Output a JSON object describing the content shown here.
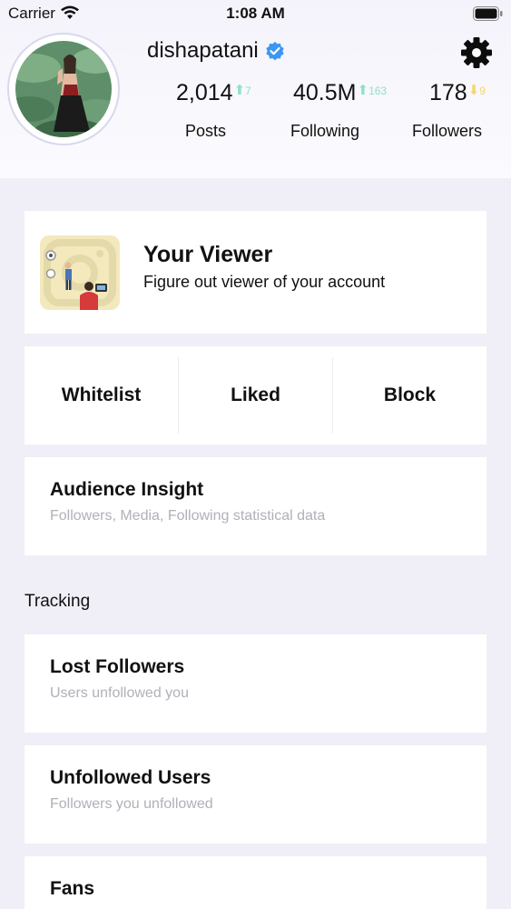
{
  "status_bar": {
    "carrier": "Carrier",
    "time": "1:08 AM"
  },
  "profile": {
    "username": "dishapatani",
    "verified_color": "#3b97f1",
    "stats": {
      "posts": {
        "value": "2,014",
        "delta": "7",
        "direction": "up",
        "label": "Posts"
      },
      "following": {
        "value": "40.5M",
        "delta": "163",
        "direction": "up",
        "label": "Following"
      },
      "followers": {
        "value": "178",
        "delta": "9",
        "direction": "down",
        "label": "Followers"
      }
    }
  },
  "viewer_card": {
    "title": "Your Viewer",
    "subtitle": "Figure out viewer of your account"
  },
  "tabs": [
    "Whitelist",
    "Liked",
    "Block"
  ],
  "audience": {
    "title": "Audience Insight",
    "subtitle": "Followers, Media, Following statistical data"
  },
  "tracking": {
    "section_label": "Tracking",
    "items": [
      {
        "title": "Lost Followers",
        "subtitle": "Users unfollowed you"
      },
      {
        "title": "Unfollowed Users",
        "subtitle": "Followers you unfollowed"
      },
      {
        "title": "Fans"
      }
    ]
  },
  "colors": {
    "delta_up": "#8ee2c4",
    "delta_down": "#f3d86a",
    "background": "#f0eff7",
    "subtitle_gray": "#b0b0b8"
  }
}
